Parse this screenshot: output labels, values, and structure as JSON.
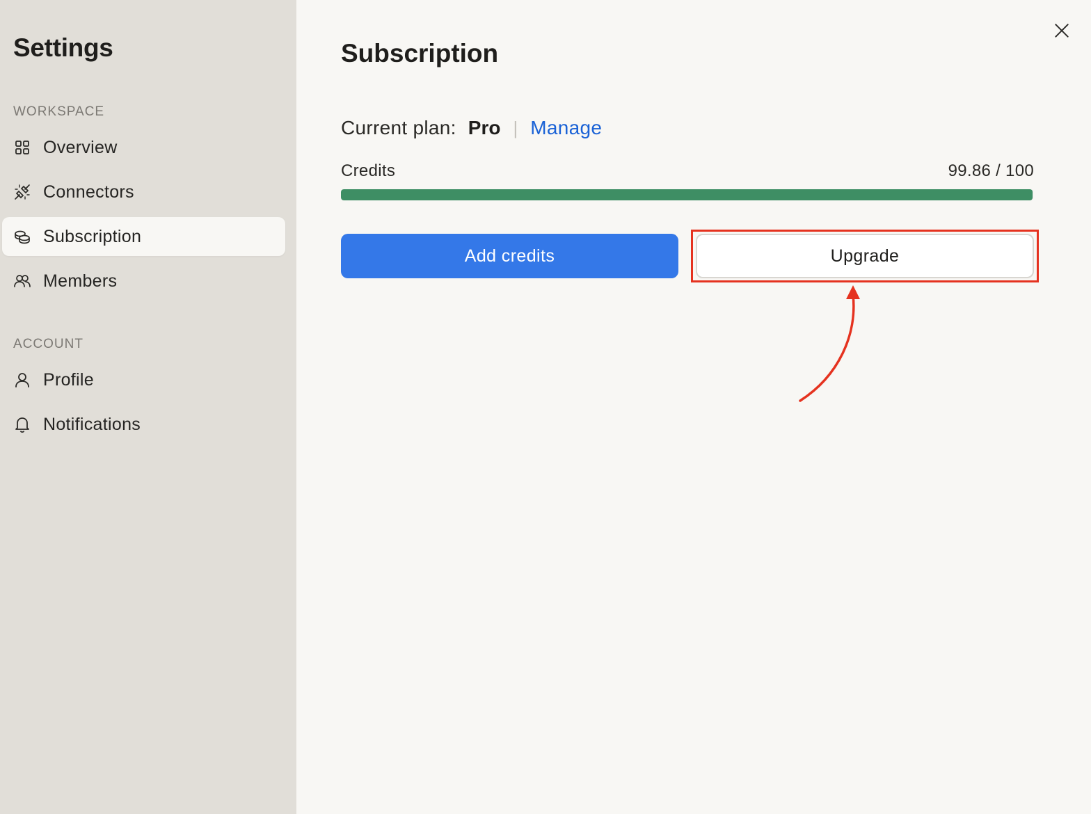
{
  "sidebar": {
    "title": "Settings",
    "sections": [
      {
        "label": "WORKSPACE",
        "items": [
          {
            "label": "Overview",
            "icon": "grid-icon"
          },
          {
            "label": "Connectors",
            "icon": "plug-icon"
          },
          {
            "label": "Subscription",
            "icon": "coins-icon",
            "active": true
          },
          {
            "label": "Members",
            "icon": "users-icon"
          }
        ]
      },
      {
        "label": "ACCOUNT",
        "items": [
          {
            "label": "Profile",
            "icon": "user-icon"
          },
          {
            "label": "Notifications",
            "icon": "bell-icon"
          }
        ]
      }
    ]
  },
  "main": {
    "title": "Subscription",
    "plan": {
      "label": "Current plan:",
      "value": "Pro",
      "separator": "|",
      "manage_label": "Manage"
    },
    "credits": {
      "label": "Credits",
      "value_text": "99.86 / 100",
      "used": 99.86,
      "total": 100
    },
    "buttons": {
      "add_credits": "Add credits",
      "upgrade": "Upgrade"
    }
  },
  "colors": {
    "sidebar_bg": "#e1ded8",
    "main_bg": "#f8f7f4",
    "primary": "#3478e8",
    "link": "#1a62d6",
    "progress": "#3e8e64",
    "annotation": "#e5321f"
  }
}
